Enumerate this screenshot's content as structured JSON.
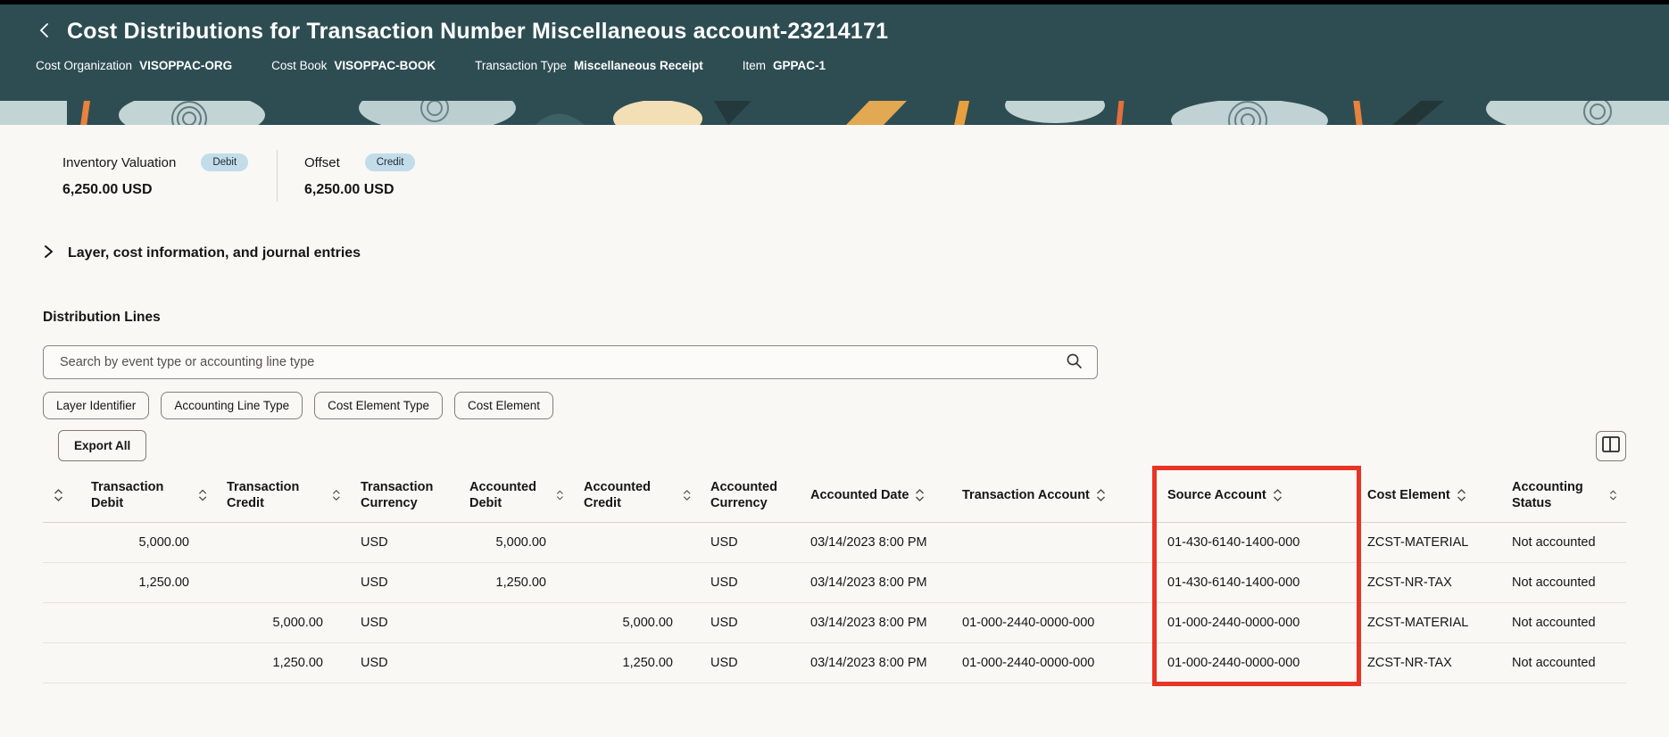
{
  "header": {
    "back_icon": "chevron-left-icon",
    "title": "Cost Distributions for Transaction Number Miscellaneous account-23214171",
    "bg_color": "#2e4d52",
    "context": [
      {
        "label": "Cost Organization",
        "value": "VISOPPAC-ORG"
      },
      {
        "label": "Cost Book",
        "value": "VISOPPAC-BOOK"
      },
      {
        "label": "Transaction Type",
        "value": "Miscellaneous Receipt"
      },
      {
        "label": "Item",
        "value": "GPPAC-1"
      }
    ]
  },
  "summary": {
    "badge_bg": "#c2dcea",
    "cards": [
      {
        "label": "Inventory Valuation",
        "badge": "Debit",
        "amount": "6,250.00 USD"
      },
      {
        "label": "Offset",
        "badge": "Credit",
        "amount": "6,250.00 USD"
      }
    ]
  },
  "sections": {
    "collapsed_section_label": "Layer, cost information, and journal entries",
    "collapse_icon": "chevron-right-icon",
    "distribution_title": "Distribution Lines"
  },
  "search": {
    "placeholder": "Search by event type or accounting line type",
    "icon": "search-icon"
  },
  "filters": [
    "Layer Identifier",
    "Accounting Line Type",
    "Cost Element Type",
    "Cost Element"
  ],
  "toolbar": {
    "export_label": "Export All",
    "columns_icon": "columns-icon"
  },
  "table": {
    "columns": [
      {
        "label": "",
        "sortable": true,
        "align": "left"
      },
      {
        "label": "Transaction Debit",
        "sortable": true,
        "align": "right"
      },
      {
        "label": "Transaction Credit",
        "sortable": true,
        "align": "right"
      },
      {
        "label": "Transaction Currency",
        "sortable": false,
        "align": "left"
      },
      {
        "label": "Accounted Debit",
        "sortable": true,
        "align": "right"
      },
      {
        "label": "Accounted Credit",
        "sortable": true,
        "align": "right"
      },
      {
        "label": "Accounted Currency",
        "sortable": false,
        "align": "left"
      },
      {
        "label": "Accounted Date",
        "sortable": true,
        "align": "left"
      },
      {
        "label": "Transaction Account",
        "sortable": true,
        "align": "left"
      },
      {
        "label": "Source Account",
        "sortable": true,
        "align": "left"
      },
      {
        "label": "Cost Element",
        "sortable": true,
        "align": "left"
      },
      {
        "label": "Accounting Status",
        "sortable": true,
        "align": "left"
      }
    ],
    "rows": [
      [
        "",
        "5,000.00",
        "",
        "USD",
        "5,000.00",
        "",
        "USD",
        "03/14/2023 8:00 PM",
        "",
        "01-430-6140-1400-000",
        "ZCST-MATERIAL",
        "Not accounted"
      ],
      [
        "",
        "1,250.00",
        "",
        "USD",
        "1,250.00",
        "",
        "USD",
        "03/14/2023 8:00 PM",
        "",
        "01-430-6140-1400-000",
        "ZCST-NR-TAX",
        "Not accounted"
      ],
      [
        "",
        "",
        "5,000.00",
        "USD",
        "",
        "5,000.00",
        "USD",
        "03/14/2023 8:00 PM",
        "01-000-2440-0000-000",
        "01-000-2440-0000-000",
        "ZCST-MATERIAL",
        "Not accounted"
      ],
      [
        "",
        "",
        "1,250.00",
        "USD",
        "",
        "1,250.00",
        "USD",
        "03/14/2023 8:00 PM",
        "01-000-2440-0000-000",
        "01-000-2440-0000-000",
        "ZCST-NR-TAX",
        "Not accounted"
      ]
    ],
    "highlight": {
      "column_label": "Source Account",
      "color": "#e93323"
    }
  }
}
